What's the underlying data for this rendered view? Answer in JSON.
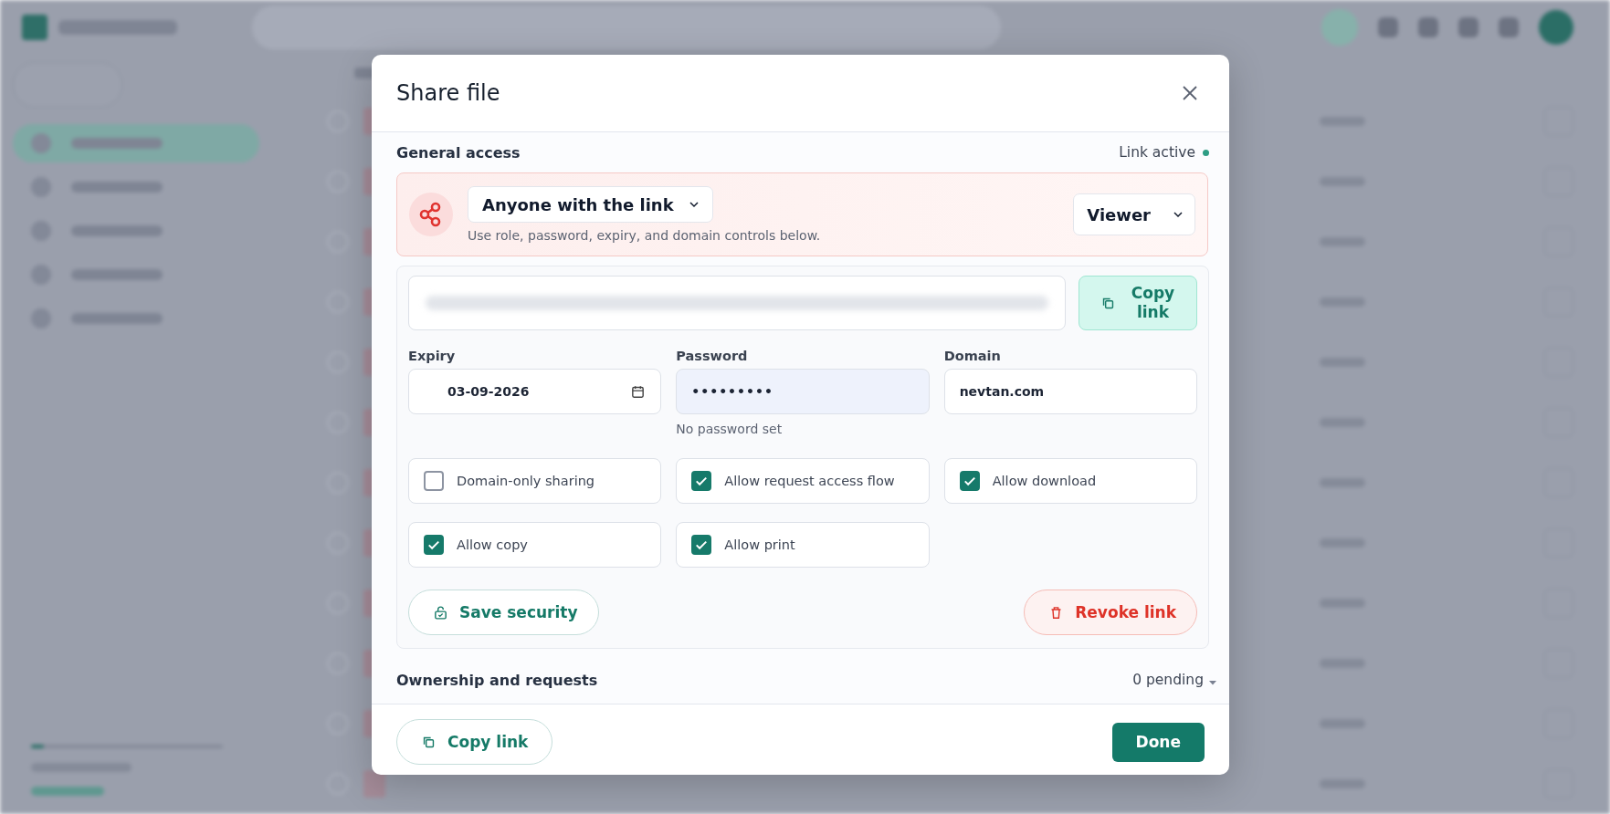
{
  "dialog": {
    "title": "Share file",
    "general_access": {
      "heading": "General access",
      "status": "Link active",
      "active": true,
      "access": "Anyone with the link",
      "hint": "Use role, password, expiry, and domain controls below.",
      "role": "Viewer"
    },
    "link": {
      "copy_button": "Copy link"
    },
    "fields": [
      {
        "kind": "date",
        "label": "Expiry",
        "value": "03-09-2026"
      },
      {
        "kind": "password",
        "label": "Password",
        "value": "•••••••••",
        "hint": "No password set"
      },
      {
        "kind": "text",
        "label": "Domain",
        "value": "nevtan.com"
      }
    ],
    "options": [
      {
        "label": "Domain-only sharing",
        "checked": false
      },
      {
        "label": "Allow request access flow",
        "checked": true
      },
      {
        "label": "Allow download",
        "checked": true
      },
      {
        "label": "Allow copy",
        "checked": true
      },
      {
        "label": "Allow print",
        "checked": true
      }
    ],
    "save_button": "Save security",
    "revoke_button": "Revoke link",
    "ownership": {
      "heading": "Ownership and requests",
      "count": "0 pending",
      "expanded": false
    },
    "footer": {
      "copy_button": "Copy link",
      "done_button": "Done"
    }
  }
}
